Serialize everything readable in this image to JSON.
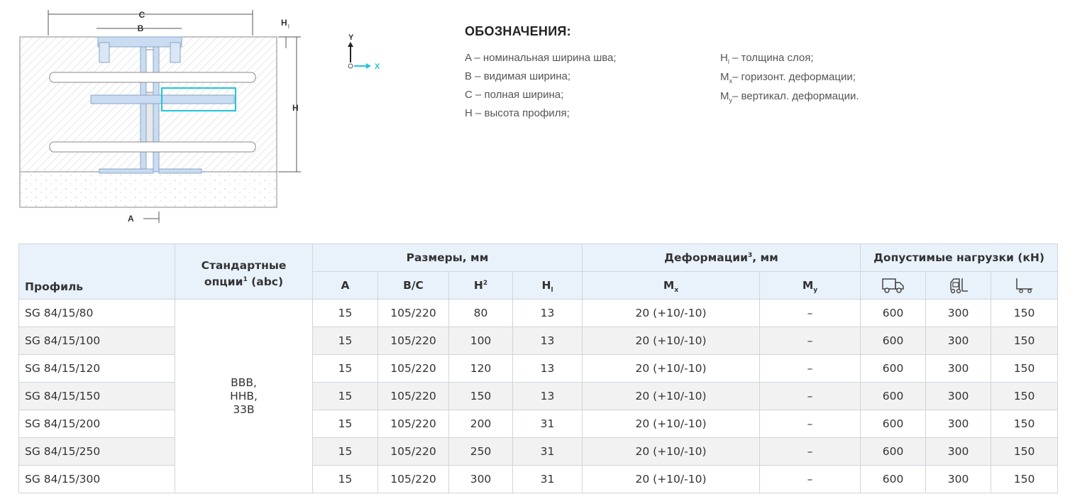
{
  "diagram": {
    "labels": {
      "c": "C",
      "b": "B",
      "hl": "H",
      "hl_sub": "l",
      "h": "H",
      "a": "A"
    }
  },
  "axes": {
    "y": "Y",
    "x": "X"
  },
  "legend": {
    "title": "ОБОЗНАЧЕНИЯ:",
    "left": [
      {
        "key": "A",
        "text": " – номинальная ширина шва;"
      },
      {
        "key": "B",
        "text": " – видимая ширина;"
      },
      {
        "key": "C",
        "text": " – полная ширина;"
      },
      {
        "key": "H",
        "text": " – высота профиля;"
      }
    ],
    "right": [
      {
        "key": "H",
        "sub": "l",
        "text": " – толщина слоя;"
      },
      {
        "key": "M",
        "sub": "x",
        "text": "– горизонт. деформации;"
      },
      {
        "key": "M",
        "sub": "y",
        "text": "– вертикал. деформации."
      }
    ]
  },
  "table": {
    "h_profile": "Профиль",
    "h_options": "Стандартные",
    "h_options2": "опции",
    "h_options_sup": "1",
    "h_options3": " (abc)",
    "h_sizes": "Размеры, мм",
    "h_deform": "Деформации",
    "h_deform_sup": "3",
    "h_deform_unit": ", мм",
    "h_loads": "Допустимые нагрузки (кН)",
    "col_a": "A",
    "col_bc": "B/C",
    "col_h": "H",
    "col_h_sup": "2",
    "col_hl": "H",
    "col_hl_sub": "l",
    "col_mx": "M",
    "col_mx_sub": "x",
    "col_my": "M",
    "col_my_sub": "y",
    "load_icons": [
      "truck-icon",
      "forklift-icon",
      "hand-cart-icon"
    ],
    "options": "BBB,\nHHB,\n33B",
    "rows": [
      {
        "profile": "SG 84/15/80",
        "a": "15",
        "bc": "105/220",
        "h": "80",
        "hl": "13",
        "mx": "20 (+10/-10)",
        "my": "–",
        "l1": "600",
        "l2": "300",
        "l3": "150"
      },
      {
        "profile": "SG 84/15/100",
        "a": "15",
        "bc": "105/220",
        "h": "100",
        "hl": "13",
        "mx": "20 (+10/-10)",
        "my": "–",
        "l1": "600",
        "l2": "300",
        "l3": "150"
      },
      {
        "profile": "SG 84/15/120",
        "a": "15",
        "bc": "105/220",
        "h": "120",
        "hl": "13",
        "mx": "20 (+10/-10)",
        "my": "–",
        "l1": "600",
        "l2": "300",
        "l3": "150"
      },
      {
        "profile": "SG 84/15/150",
        "a": "15",
        "bc": "105/220",
        "h": "150",
        "hl": "13",
        "mx": "20 (+10/-10)",
        "my": "–",
        "l1": "600",
        "l2": "300",
        "l3": "150"
      },
      {
        "profile": "SG 84/15/200",
        "a": "15",
        "bc": "105/220",
        "h": "200",
        "hl": "31",
        "mx": "20 (+10/-10)",
        "my": "–",
        "l1": "600",
        "l2": "300",
        "l3": "150"
      },
      {
        "profile": "SG 84/15/250",
        "a": "15",
        "bc": "105/220",
        "h": "250",
        "hl": "31",
        "mx": "20 (+10/-10)",
        "my": "–",
        "l1": "600",
        "l2": "300",
        "l3": "150"
      },
      {
        "profile": "SG 84/15/300",
        "a": "15",
        "bc": "105/220",
        "h": "300",
        "hl": "31",
        "mx": "20 (+10/-10)",
        "my": "–",
        "l1": "600",
        "l2": "300",
        "l3": "150"
      }
    ]
  },
  "colors": {
    "accent": "#20c4d8",
    "header_bg": "#e9f2fb",
    "profile_fill": "#c9dcf2",
    "border": "#cfd5dc"
  }
}
